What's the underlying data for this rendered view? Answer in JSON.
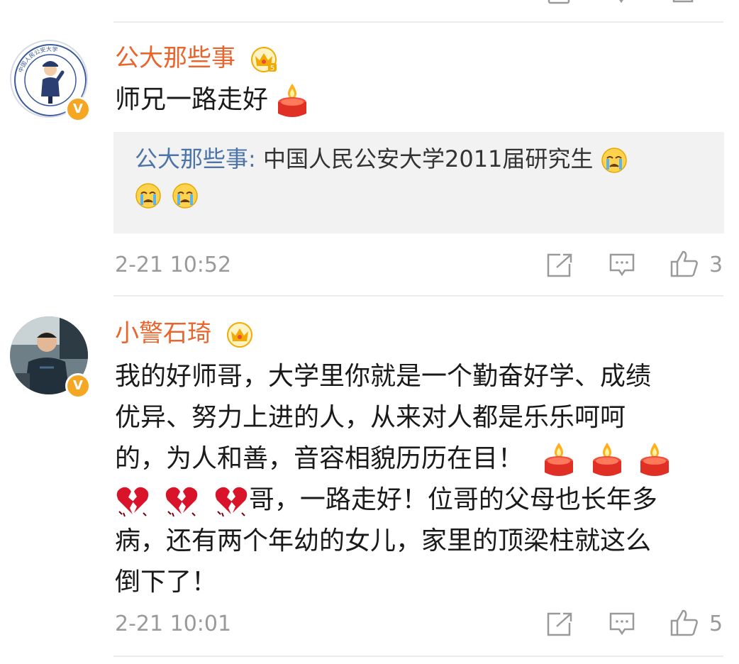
{
  "comments": [
    {
      "username": "公大那些事",
      "text": "师兄一路走好",
      "reply": {
        "username": "公大那些事:",
        "text_line1": " 中国人民公安大学2011届研究生",
        "text_line2": ""
      },
      "timestamp": "2-21 10:52",
      "likes": "3"
    },
    {
      "username": "小警石琦",
      "text_lines": [
        "我的好师哥，大学里你就是一个勤奋好学、成绩",
        "优异、努力上进的人，从来对人都是乐乐呵呵",
        "的，为人和善，音容相貌历历在目！",
        "哥，一路走好！位哥的父母也长年多",
        "病，还有两个年幼的女儿，家里的顶梁柱就这么",
        "倒下了！"
      ],
      "timestamp": "2-21 10:01",
      "likes": "5"
    }
  ],
  "icons": {
    "verified": "verified-v-icon",
    "crown": "crown-level-icon",
    "candle": "candle-icon",
    "crying": "crying-face-icon",
    "broken_heart": "broken-heart-icon",
    "share": "share-icon",
    "comment": "comment-icon",
    "like": "thumbs-up-icon"
  },
  "colors": {
    "username": "#e8662d",
    "reply_username": "#4d74a8",
    "meta": "#9a9a9a",
    "verified_badge": "#f5a623",
    "reply_bg": "#f2f2f2"
  },
  "avatar1": {
    "seal_text": "中国人民公安大学"
  }
}
